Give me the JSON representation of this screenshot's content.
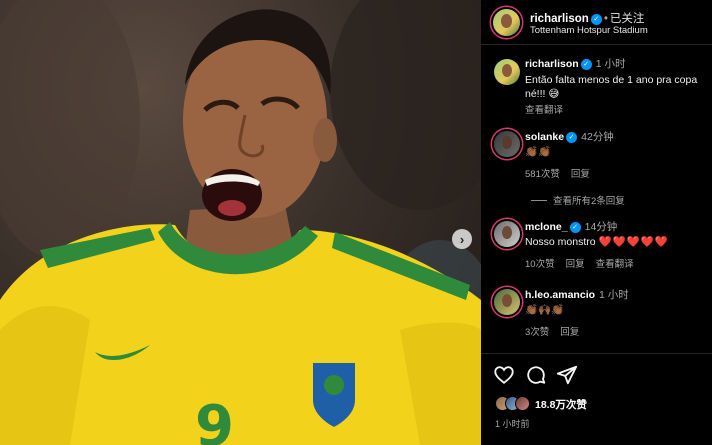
{
  "photo": {
    "alt": "",
    "jersey_number": "9",
    "next_glyph": "›"
  },
  "header": {
    "username": "richarlison",
    "verified_glyph": "✓",
    "dot": "•",
    "follow_status": "已关注",
    "location": "Tottenham Hotspur Stadium"
  },
  "caption": {
    "username": "richarlison",
    "time": "1 小时",
    "text_line1": "Então falta menos de 1 ano pra copa",
    "text_line2": "né!!! 😅",
    "translate": "查看翻译"
  },
  "comments": [
    {
      "username": "solanke",
      "verified": true,
      "time": "42分钟",
      "text": "👏🏾👏🏾",
      "likes": "581次赞",
      "reply": "回复",
      "view_replies": "查看所有2条回复"
    },
    {
      "username": "mclone_",
      "verified": true,
      "time": "14分钟",
      "text": "Nosso monstro",
      "hearts": "❤️❤️❤️❤️❤️",
      "likes": "10次赞",
      "reply": "回复",
      "translate": "查看翻译"
    },
    {
      "username": "h.leo.amancio",
      "verified": false,
      "time": "1 小时",
      "text": "👏🏾🙌🏾👏🏾",
      "likes": "3次赞",
      "reply": "回复"
    }
  ],
  "actions": {
    "like_icon": "heart-icon",
    "comment_icon": "comment-icon",
    "share_icon": "share-icon",
    "likes_count": "18.8万次赞",
    "post_time": "1 小时前"
  },
  "colors": {
    "accent": "#0095f6",
    "jersey_yellow": "#f2d21b",
    "jersey_green": "#2f8a3c",
    "background": "#000000"
  }
}
